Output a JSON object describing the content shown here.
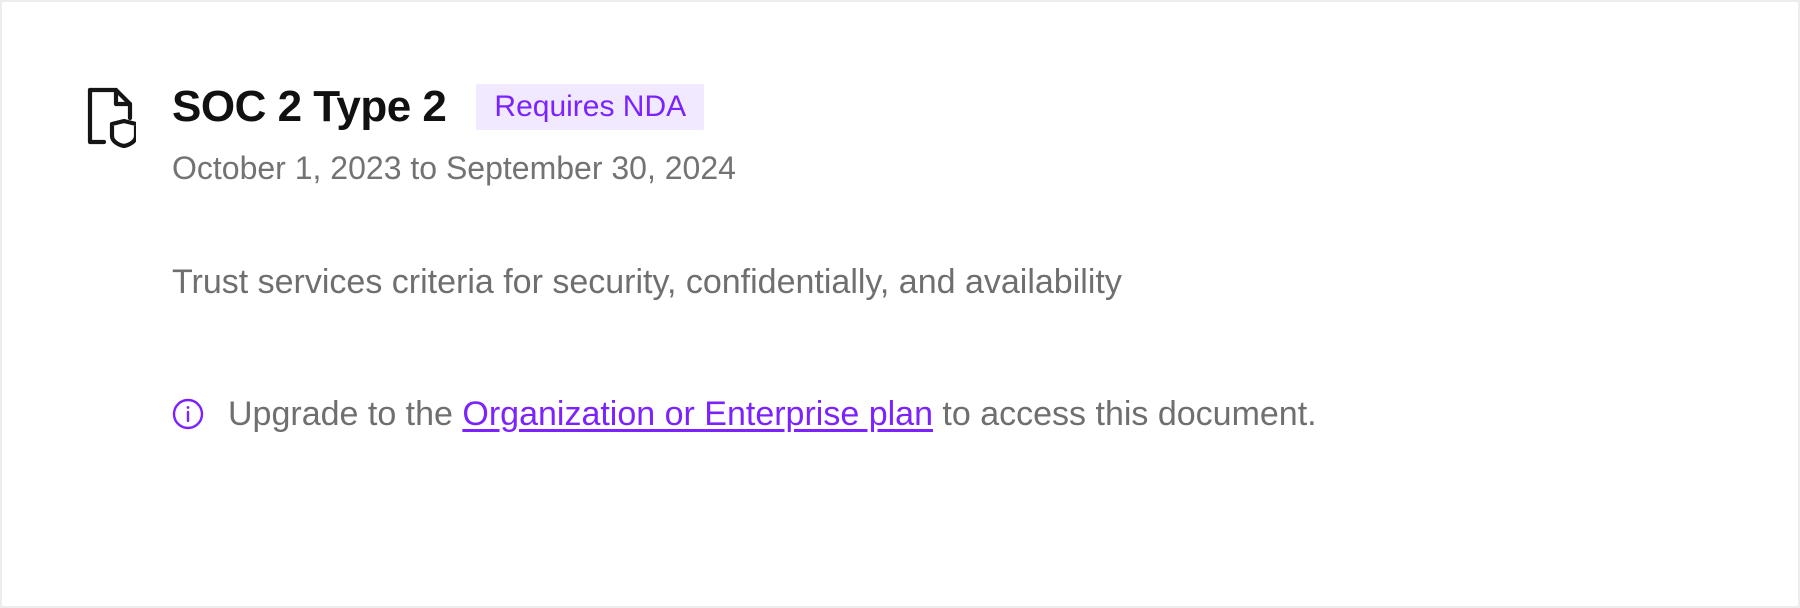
{
  "document": {
    "title": "SOC 2 Type 2",
    "badge": "Requires NDA",
    "date_range": "October 1, 2023 to September 30, 2024",
    "description": "Trust services criteria for security, confidentially, and availability"
  },
  "notice": {
    "prefix": "Upgrade to the ",
    "link_text": "Organization or Enterprise plan",
    "suffix": " to access this document."
  },
  "colors": {
    "accent_purple": "#7c22ff",
    "badge_bg": "#f0e9ff",
    "text_muted": "#6f6f6f",
    "border": "#ededed"
  }
}
